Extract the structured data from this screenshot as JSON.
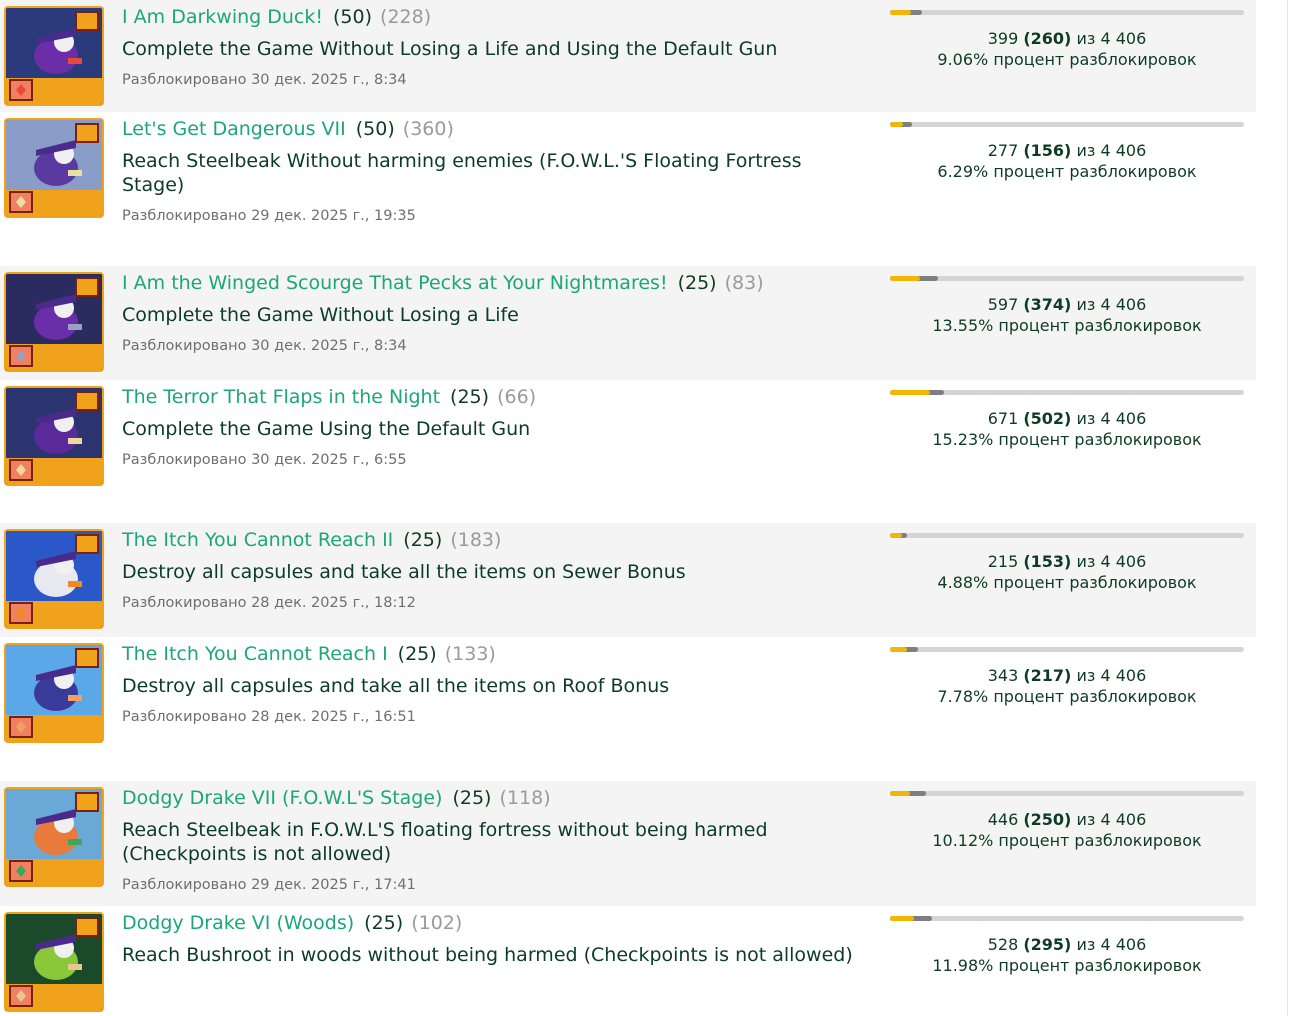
{
  "achievements": [
    {
      "title": "I Am Darkwing Duck!",
      "points": "(50)",
      "retro_points": "(228)",
      "description": "Complete the Game Without Losing a Life and Using the Default Gun",
      "unlocked": "Разблокировано 30 дек. 2025 г., 8:34",
      "total": "399",
      "hardcore": "(260)",
      "of_label": "из",
      "players": "4 406",
      "percent": "9.06% процент разблокировок",
      "total_ratio": 0.0906,
      "hardcore_ratio": 0.059,
      "icon": "darkwing-duck-badge-icon"
    },
    {
      "title": "Let's Get Dangerous VII",
      "points": "(50)",
      "retro_points": "(360)",
      "description": "Reach Steelbeak Without harming enemies (F.O.W.L.'S Floating Fortress Stage)",
      "unlocked": "Разблокировано 29 дек. 2025 г., 19:35",
      "total": "277",
      "hardcore": "(156)",
      "of_label": "из",
      "players": "4 406",
      "percent": "6.29% процент разблокировок",
      "total_ratio": 0.0629,
      "hardcore_ratio": 0.0354,
      "icon": "fortress-stage-badge-icon"
    },
    {
      "title": "I Am the Winged Scourge That Pecks at Your Nightmares!",
      "points": "(25)",
      "retro_points": "(83)",
      "description": "Complete the Game Without Losing a Life",
      "unlocked": "Разблокировано 30 дек. 2025 г., 8:34",
      "total": "597",
      "hardcore": "(374)",
      "of_label": "из",
      "players": "4 406",
      "percent": "13.55% процент разблокировок",
      "total_ratio": 0.1355,
      "hardcore_ratio": 0.0849,
      "icon": "winged-scourge-badge-icon"
    },
    {
      "title": "The Terror That Flaps in the Night",
      "points": "(25)",
      "retro_points": "(66)",
      "description": "Complete the Game Using the Default Gun",
      "unlocked": "Разблокировано 30 дек. 2025 г., 6:55",
      "total": "671",
      "hardcore": "(502)",
      "of_label": "из",
      "players": "4 406",
      "percent": "15.23% процент разблокировок",
      "total_ratio": 0.1523,
      "hardcore_ratio": 0.1139,
      "icon": "ratcatcher-badge-icon"
    },
    {
      "title": "The Itch You Cannot Reach II",
      "points": "(25)",
      "retro_points": "(183)",
      "description": "Destroy all capsules and take all the items on Sewer Bonus",
      "unlocked": "Разблокировано 28 дек. 2025 г., 18:12",
      "total": "215",
      "hardcore": "(153)",
      "of_label": "из",
      "players": "4 406",
      "percent": "4.88% процент разблокировок",
      "total_ratio": 0.0488,
      "hardcore_ratio": 0.0347,
      "icon": "sewer-bonus-badge-icon"
    },
    {
      "title": "The Itch You Cannot Reach I",
      "points": "(25)",
      "retro_points": "(133)",
      "description": "Destroy all capsules and take all the items on Roof Bonus",
      "unlocked": "Разблокировано 28 дек. 2025 г., 16:51",
      "total": "343",
      "hardcore": "(217)",
      "of_label": "из",
      "players": "4 406",
      "percent": "7.78% процент разблокировок",
      "total_ratio": 0.0778,
      "hardcore_ratio": 0.0493,
      "icon": "roof-bonus-badge-icon"
    },
    {
      "title": "Dodgy Drake VII (F.O.W.L'S Stage)",
      "points": "(25)",
      "retro_points": "(118)",
      "description": "Reach Steelbeak in F.O.W.L'S floating fortress without being harmed (Checkpoints is not allowed)",
      "unlocked": "Разблокировано 29 дек. 2025 г., 17:41",
      "total": "446",
      "hardcore": "(250)",
      "of_label": "из",
      "players": "4 406",
      "percent": "10.12% процент разблокировок",
      "total_ratio": 0.1012,
      "hardcore_ratio": 0.0567,
      "icon": "dodgy-drake-fowl-badge-icon"
    },
    {
      "title": "Dodgy Drake VI (Woods)",
      "points": "(25)",
      "retro_points": "(102)",
      "description": "Reach Bushroot in woods without being harmed (Checkpoints is not allowed)",
      "unlocked": "",
      "total": "528",
      "hardcore": "(295)",
      "of_label": "из",
      "players": "4 406",
      "percent": "11.98% процент разблокировок",
      "total_ratio": 0.1198,
      "hardcore_ratio": 0.067,
      "icon": "dodgy-drake-woods-badge-icon"
    }
  ],
  "colors": {
    "title": "#1ca67a",
    "text": "#0e3b24",
    "muted": "#9a9a9a",
    "bar_bg": "#d4d4d4",
    "bar_hardcore": "#f2b705",
    "bar_total": "#7f7f7f",
    "badge_border": "#f0a21a"
  }
}
